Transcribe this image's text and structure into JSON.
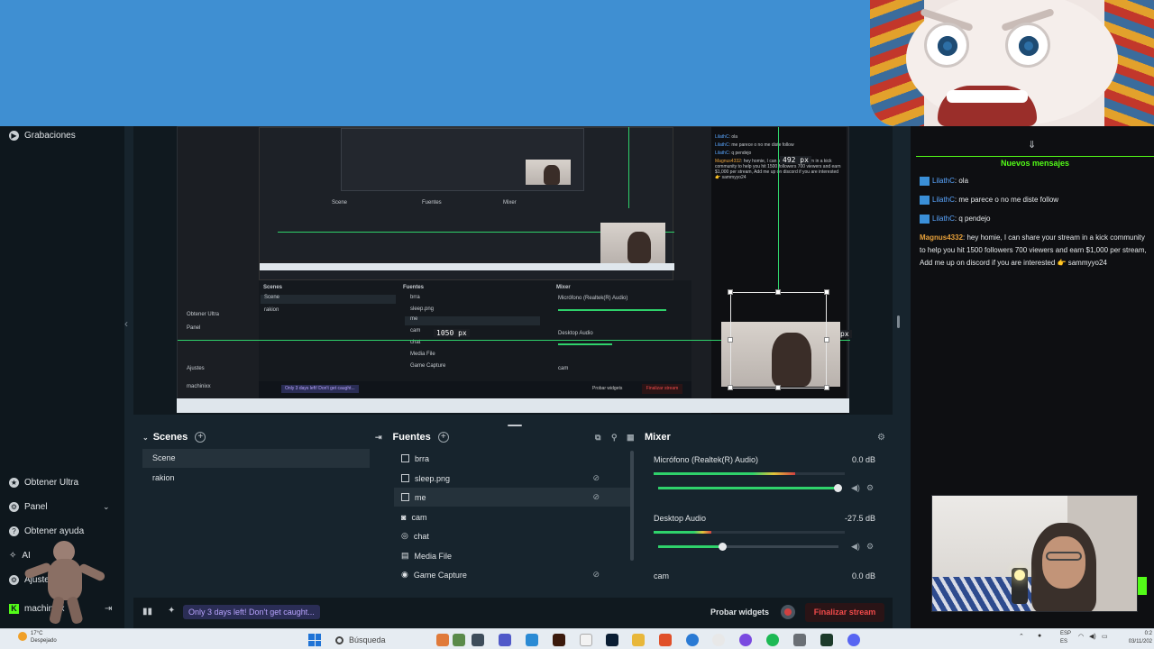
{
  "sidebar": {
    "recordings": "Grabaciones",
    "get_ultra": "Obtener Ultra",
    "panel": "Panel",
    "get_help": "Obtener ayuda",
    "ai": "AI",
    "settings": "Ajustes",
    "username": "machinixx"
  },
  "preview": {
    "px_label_1": "492 px",
    "px_label_2": "1050 px",
    "px_label_3": "px"
  },
  "scenes": {
    "title": "Scenes",
    "items": [
      "Scene",
      "rakion"
    ]
  },
  "sources": {
    "title": "Fuentes",
    "items": [
      "brra",
      "sleep.png",
      "me",
      "cam",
      "chat",
      "Media File",
      "Game Capture"
    ]
  },
  "mixer": {
    "title": "Mixer",
    "channels": [
      {
        "name": "Micrófono (Realtek(R) Audio)",
        "db": "0.0 dB",
        "level": 0.74,
        "volume": 1.0
      },
      {
        "name": "Desktop Audio",
        "db": "-27.5 dB",
        "level": 0.3,
        "volume": 0.36
      },
      {
        "name": "cam",
        "db": "0.0 dB"
      }
    ]
  },
  "statusbar": {
    "promo": "Only 3 days left! Don't get caught...",
    "test_widgets": "Probar widgets",
    "end_stream": "Finalizar stream"
  },
  "chat": {
    "new_messages": "Nuevos mensajes",
    "messages": [
      {
        "user": "LilathC",
        "text": ": ola"
      },
      {
        "user": "LilathC",
        "text": ": me parece o no me diste follow"
      },
      {
        "user": "LilathC",
        "text": ": q pendejo"
      },
      {
        "user": "Magnus4332",
        "text": ": hey homie, I can share your stream in a kick community to help you hit 1500 followers 700 viewers and earn $1,000 per stream, Add me up on discord if you are interested 👉 sammyyo24"
      }
    ]
  },
  "taskbar": {
    "temperature": "17°C",
    "weather": "Despejado",
    "search": "Búsqueda",
    "lang": "ESP",
    "lang2": "ES",
    "time": "0:2",
    "date": "03/11/202"
  },
  "colors": {
    "kick_green": "#53fc18",
    "accent_red": "#f14a4a",
    "chat_user_blue": "#5aa6ff",
    "chat_user_gold": "#e8a13a",
    "banner_blue": "#3f8fd2"
  }
}
